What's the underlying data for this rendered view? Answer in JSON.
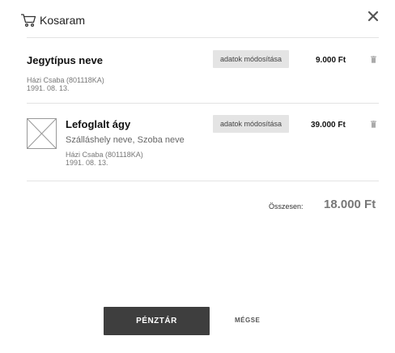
{
  "header": {
    "title": "Kosaram"
  },
  "items": [
    {
      "name": "Jegytípus neve",
      "meta_line1": "Házi Csaba (801118KA)",
      "meta_line2": "1991. 08. 13.",
      "action_label": "adatok módosítása",
      "price": "9.000 Ft"
    },
    {
      "name": "Lefoglalt ágy",
      "subtitle": "Szálláshely neve, Szoba neve",
      "meta_line1": "Házi Csaba (801118KA)",
      "meta_line2": "1991. 08. 13.",
      "action_label": "adatok módosítása",
      "price": "39.000 Ft"
    }
  ],
  "summary": {
    "total_label": "Összesen:",
    "total_value": "18.000 Ft"
  },
  "footer": {
    "checkout_label": "PÉNZTÁR",
    "cancel_label": "MÉGSE"
  },
  "icons": {
    "cart": "shopping-cart-icon",
    "close": "close-icon",
    "trash": "trash-icon",
    "image": "image-placeholder-icon"
  }
}
